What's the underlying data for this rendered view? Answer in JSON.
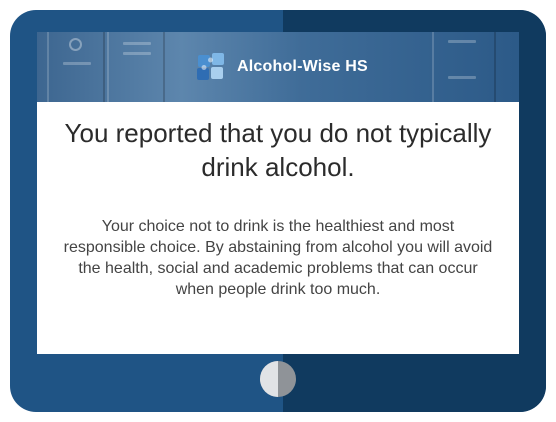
{
  "banner": {
    "logo_icon": "puzzle-pieces-icon",
    "app_name": "Alcohol-Wise HS"
  },
  "content": {
    "headline": "You reported that you do not typically drink alcohol.",
    "body": "Your choice not to drink is the healthiest and most responsible choice. By abstaining from alcohol you will avoid the health, social and academic problems that can occur when people drink too much."
  },
  "device": {
    "home_button_icon": "home-button-icon"
  },
  "colors": {
    "tablet_frame_left": "#1f5485",
    "tablet_frame_right": "#103a5f",
    "banner_blue": "#3f6c98",
    "headline_text": "#2b2b2b",
    "body_text": "#444444",
    "logo_pieces": [
      "#4a8fd0",
      "#7fb7e6",
      "#2f6db3",
      "#a9cfee"
    ]
  }
}
